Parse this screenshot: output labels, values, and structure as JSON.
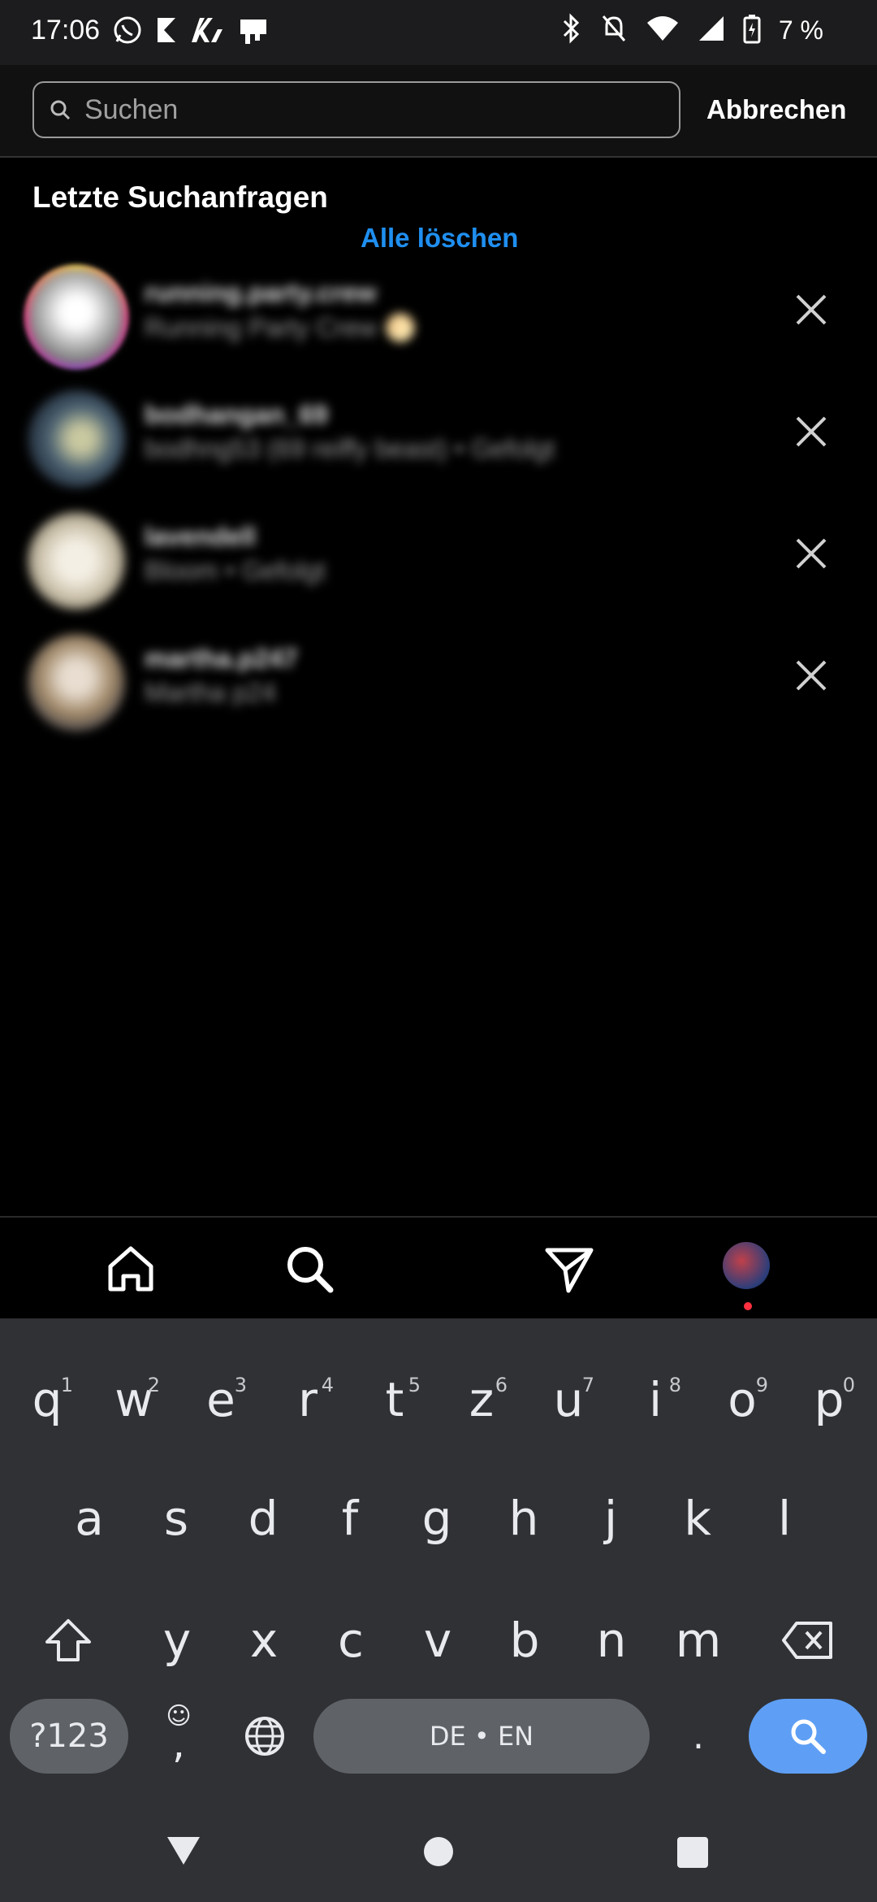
{
  "status_bar": {
    "time": "17:06",
    "battery_text": "7 %",
    "left_icons": [
      "whatsapp-icon",
      "k-app-icon",
      "kr-app-icon",
      "sim-app-icon"
    ],
    "right_icons": [
      "bluetooth-icon",
      "notifications-off-icon",
      "wifi-icon",
      "signal-icon",
      "battery-charging-icon"
    ]
  },
  "search": {
    "placeholder": "Suchen",
    "value": "",
    "cancel_label": "Abbrechen"
  },
  "recent": {
    "title": "Letzte Suchanfragen",
    "clear_all_label": "Alle löschen",
    "items": [
      {
        "name": "running.party.crew",
        "subtitle": "Running Party Crew 🌕"
      },
      {
        "name": "bodhangan_69",
        "subtitle": "bodhng53 (69 reiffy beast) • Gefolgt"
      },
      {
        "name": "lavendell",
        "subtitle": "Bloom • Gefolgt"
      },
      {
        "name": "martha.p247",
        "subtitle": "Martha p24"
      }
    ]
  },
  "bottom_nav": {
    "items": [
      "home-icon",
      "search-icon",
      "direct-messages-icon",
      "profile-avatar"
    ]
  },
  "keyboard": {
    "row1": [
      {
        "k": "q",
        "h": "1"
      },
      {
        "k": "w",
        "h": "2"
      },
      {
        "k": "e",
        "h": "3"
      },
      {
        "k": "r",
        "h": "4"
      },
      {
        "k": "t",
        "h": "5"
      },
      {
        "k": "z",
        "h": "6"
      },
      {
        "k": "u",
        "h": "7"
      },
      {
        "k": "i",
        "h": "8"
      },
      {
        "k": "o",
        "h": "9"
      },
      {
        "k": "p",
        "h": "0"
      }
    ],
    "row2": [
      "a",
      "s",
      "d",
      "f",
      "g",
      "h",
      "j",
      "k",
      "l"
    ],
    "row3": [
      "y",
      "x",
      "c",
      "v",
      "b",
      "n",
      "m"
    ],
    "numbers_label": "?123",
    "comma_label": ",",
    "space_label": "DE • EN",
    "period_label": ".",
    "action_color": "#5e9ff5"
  },
  "system_nav": [
    "back-icon",
    "home-circle-icon",
    "recents-icon"
  ]
}
